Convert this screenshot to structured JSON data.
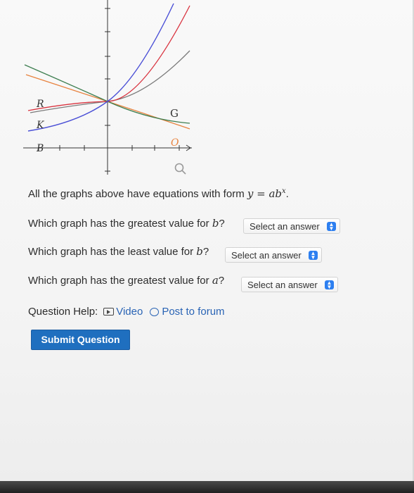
{
  "graph": {
    "curves": [
      {
        "label": "R",
        "color": "#d9333f"
      },
      {
        "label": "K",
        "color": "#4a4fd6"
      },
      {
        "label": "G",
        "color": "#3e7f51"
      },
      {
        "label": "O",
        "color": "#e8833f"
      },
      {
        "label": "B",
        "color": "#777777"
      }
    ]
  },
  "question": {
    "intro_prefix": "All the graphs above have equations with form ",
    "intro_math": "y = ab",
    "intro_exp": "x",
    "intro_suffix": ".",
    "items": [
      {
        "prefix": "Which graph has the greatest value for ",
        "var": "b",
        "suffix": "?",
        "select_value": "Select an answer"
      },
      {
        "prefix": "Which graph has the least value for ",
        "var": "b",
        "suffix": "?",
        "select_value": "Select an answer"
      },
      {
        "prefix": "Which graph has the greatest value for ",
        "var": "a",
        "suffix": "?",
        "select_value": "Select an answer"
      }
    ]
  },
  "help": {
    "label": "Question Help:",
    "video": "Video",
    "forum": "Post to forum"
  },
  "submit_label": "Submit Question",
  "colors": {
    "accent": "#2d7ff0",
    "button": "#1f6fbf",
    "link": "#2a64b5"
  }
}
